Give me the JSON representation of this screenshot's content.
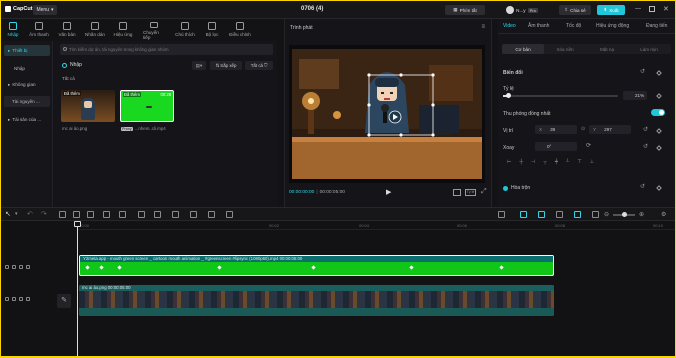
{
  "app": {
    "name": "CapCut",
    "menu_label": "Menu",
    "doc_title": "0706 (4)"
  },
  "titlebar": {
    "shortcut_label": "Phím tắt",
    "user_name": "N...y",
    "badge": "Pro",
    "share_label": "Chia sẻ",
    "export_label": "Xuất"
  },
  "toolbar": {
    "items": [
      {
        "label": "Nhập",
        "icon": "import-icon"
      },
      {
        "label": "Âm thanh",
        "icon": "audio-icon"
      },
      {
        "label": "Văn bản",
        "icon": "text-icon"
      },
      {
        "label": "Nhãn dán",
        "icon": "sticker-icon"
      },
      {
        "label": "Hiệu ứng",
        "icon": "effects-icon"
      },
      {
        "label": "Chuyển tiếp",
        "icon": "transition-icon"
      },
      {
        "label": "Chú thích",
        "icon": "caption-icon"
      },
      {
        "label": "Bộ lọc",
        "icon": "filter-icon"
      },
      {
        "label": "Điều chỉnh",
        "icon": "adjust-icon"
      }
    ]
  },
  "leftnav": {
    "items": [
      "Thiết bị",
      "Nhập",
      "Không gian",
      "Tài nguyên ...",
      "Tài sản của ..."
    ]
  },
  "media": {
    "search_placeholder": "Tìm kiếm dự án, tài nguyên trong không gian nhóm",
    "import_label": "Nhập",
    "sort_label": "Sắp xếp",
    "filter_label": "Tất cả",
    "section_label": "Tất cả",
    "items": [
      {
        "tag": "Đã thêm",
        "name": "mc ai ảo.png",
        "duration": ""
      },
      {
        "tag": "Đã thêm",
        "name": "...nhem..cli.mp4",
        "badge": "Proxy",
        "duration": "00:28"
      }
    ]
  },
  "player": {
    "title": "Trình phát",
    "current_time": "00:00:00:00",
    "total_time": "00:00:05:00",
    "ratio_label": "Tỷ lệ"
  },
  "props": {
    "tabs": [
      "Video",
      "Âm thanh",
      "Tốc độ",
      "Hiệu ứng động",
      "Đang tiến"
    ],
    "sub_tabs": [
      "Cơ bản",
      "Xóa nền",
      "Mặt nạ",
      "Làm mịn"
    ],
    "transform_label": "Biến đổi",
    "scale_label": "Tỷ lệ",
    "scale_value": "21%",
    "uniform_label": "Thu phóng đồng nhất",
    "position_label": "Vị trí",
    "pos_x_label": "X",
    "pos_x": "39",
    "pos_y_label": "Y",
    "pos_y": "297",
    "rotate_label": "Xoay",
    "rotate_value": "0°",
    "blend_label": "Hòa trộn"
  },
  "timeline": {
    "ruler": [
      "00:00",
      "00:02",
      "00:04",
      "00:06",
      "00:08",
      "00:10"
    ],
    "clip1_label": "Y2meta.app - mouth green screen _ cartoon mouth animation _ #greenscreen #lipsync (1080p60).mp4   00:00:05:00",
    "clip2_label": "mc ai ảo.png   00:00:05:00"
  },
  "colors": {
    "accent": "#2ed6e6",
    "green_clip": "#10c617",
    "image_clip": "#1a6c6a",
    "frame": "#f5d400"
  }
}
